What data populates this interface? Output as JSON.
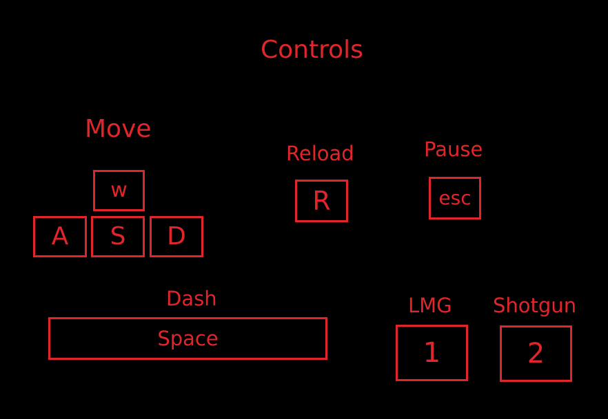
{
  "title": "Controls",
  "colors": {
    "background": "#000000",
    "accent": "#e0252b"
  },
  "move": {
    "label": "Move",
    "keys": {
      "up": "w",
      "left": "A",
      "down": "S",
      "right": "D"
    }
  },
  "reload": {
    "label": "Reload",
    "key": "R"
  },
  "pause": {
    "label": "Pause",
    "key": "esc"
  },
  "dash": {
    "label": "Dash",
    "key": "Space"
  },
  "weapons": {
    "lmg": {
      "label": "LMG",
      "key": "1"
    },
    "shotgun": {
      "label": "Shotgun",
      "key": "2"
    }
  }
}
